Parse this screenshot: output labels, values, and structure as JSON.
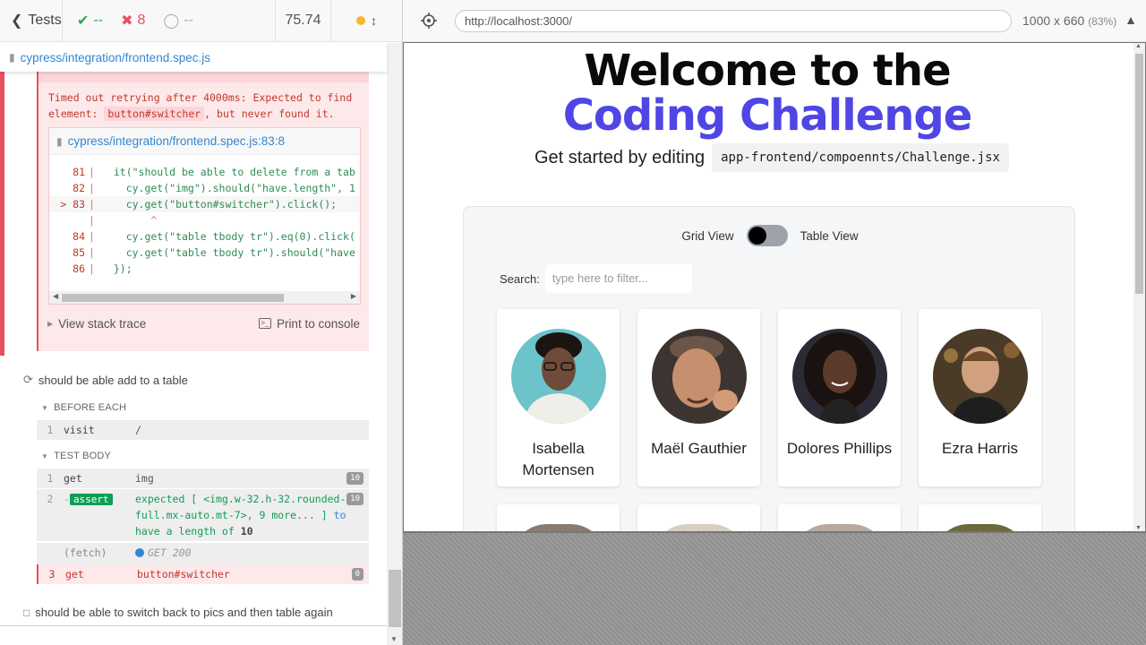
{
  "reporter": {
    "header": {
      "tests_label": "Tests",
      "passed": "--",
      "failed": "8",
      "pending": "--",
      "duration": "75.74"
    },
    "spec_file": "cypress/integration/frontend.spec.js",
    "error": {
      "message_pre": "Timed out retrying after 4000ms: Expected to find element: ",
      "message_token": "button#switcher",
      "message_post": ", but never found it.",
      "code_frame_file": "cypress/integration/frontend.spec.js:83:8",
      "code_lines": [
        {
          "num": "81",
          "marker": "|",
          "text": "  it(\"should be able to delete from a tab"
        },
        {
          "num": "82",
          "marker": "|",
          "text": "    cy.get(\"img\").should(\"have.length\", 1"
        },
        {
          "num": "> 83",
          "marker": "|",
          "text": "    cy.get(\"button#switcher\").click();"
        },
        {
          "num": "",
          "marker": "|",
          "text": "        ^"
        },
        {
          "num": "84",
          "marker": "|",
          "text": "    cy.get(\"table tbody tr\").eq(0).click("
        },
        {
          "num": "85",
          "marker": "|",
          "text": "    cy.get(\"table tbody tr\").should(\"have"
        },
        {
          "num": "86",
          "marker": "|",
          "text": "  });"
        }
      ],
      "view_stack_trace": "View stack trace",
      "print_to_console": "Print to console"
    },
    "test2_title": "should be able add to a table",
    "before_each_label": "BEFORE EACH",
    "before_each_cmd": {
      "num": "1",
      "name": "visit",
      "msg": "/"
    },
    "test_body_label": "TEST BODY",
    "commands": [
      {
        "num": "1",
        "name": "get",
        "msg": "img",
        "badge": "10"
      },
      {
        "num": "2",
        "name": "-assert",
        "msg": "expected [ <img.w-32.h-32.rounded-full.mx-auto.mt-7>, 9 more... ] to have a length of 10",
        "badge": "10"
      },
      {
        "num": "",
        "name": "(fetch)",
        "msg": "GET 200 https://randomuser.me/api/..."
      },
      {
        "num": "3",
        "name": "get",
        "msg": "button#switcher",
        "badge": "0"
      }
    ],
    "assert_parts": {
      "dash": "-",
      "badge": "assert",
      "msg1": "expected [ <img.w-32.h-32.rounded-",
      "msg2": "full.mx-auto.mt-7>, 9 more... ]",
      "to": " to",
      "msg3": "have a length of ",
      "count": "10"
    },
    "test3_title": "should be able to switch back to pics and then table again"
  },
  "aut": {
    "url": "http://localhost:3000/",
    "viewport": "1000 x 660",
    "zoom": "(83%)",
    "app": {
      "title_line1": "Welcome to the",
      "title_line2": "Coding Challenge",
      "subtitle": "Get started by editing",
      "code_path": "app-frontend/compoennts/Challenge.jsx",
      "grid_view": "Grid View",
      "table_view": "Table View",
      "search_label": "Search:",
      "search_placeholder": "type here to filter...",
      "people": [
        {
          "name": "Isabella Mortensen",
          "skin": "#6e4b3a",
          "bg": "#6cc3c9"
        },
        {
          "name": "Maël Gauthier",
          "skin": "#c68f6e",
          "bg": "#3b3430"
        },
        {
          "name": "Dolores Phillips",
          "skin": "#5a3a2a",
          "bg": "#2b2a35"
        },
        {
          "name": "Ezra Harris",
          "skin": "#d1a07f",
          "bg": "#4a3a28"
        }
      ]
    }
  },
  "colors": {
    "accent": "#4f46e5",
    "fail": "#e94f5f",
    "pass": "#31a354",
    "link": "#3386d4"
  }
}
